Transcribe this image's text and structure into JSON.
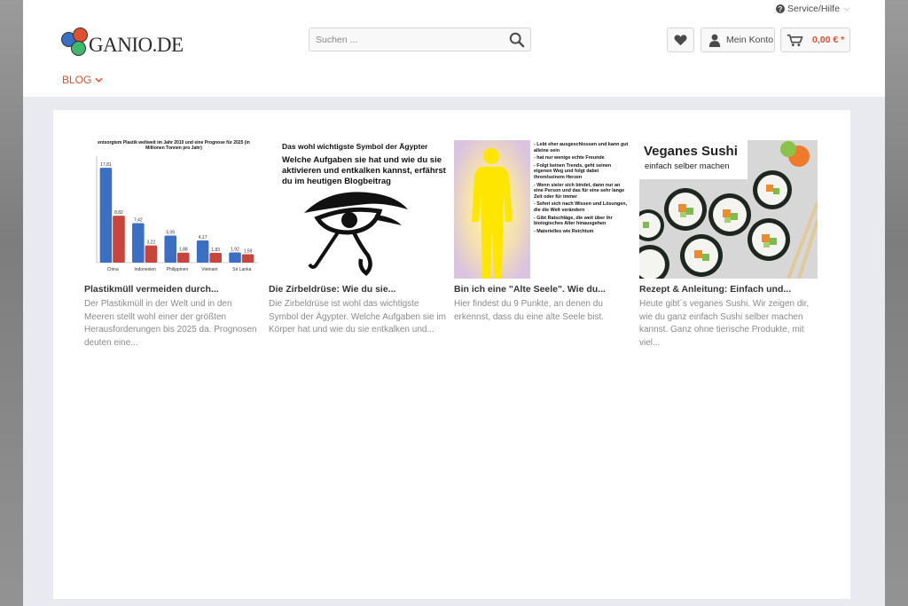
{
  "header": {
    "service_label": "Service/Hilfe",
    "logo_text": "GANIO.DE",
    "search_placeholder": "Suchen ...",
    "account_label": "Mein Konto",
    "cart_total": "0,00 € *",
    "nav_blog": "BLOG"
  },
  "colors": {
    "accent": "#e0502d",
    "bar_blue": "#3b6fc4",
    "bar_red": "#c8453b"
  },
  "icons": [
    "question-icon",
    "chevron-down-icon",
    "search-icon",
    "heart-icon",
    "user-icon",
    "cart-icon"
  ],
  "posts": [
    {
      "title": "Plastikmüll vermeiden durch...",
      "excerpt": "Der Plastikmüll in der Welt und in den Meeren stellt wohl einer der größten Herausforderungen bis 2025 da. Prognosen deuten eine..."
    },
    {
      "title": "Die Zirbeldrüse: Wie du sie...",
      "excerpt": "Die Zirbeldrüse ist wohl das wichtigste Symbol der Ägypter. Welche Aufgaben sie im Körper hat und wie du sie entkalken und...",
      "image_heading": "Das wohl wichtigste Symbol der Ägypter",
      "image_text": "Welche Aufgaben sie hat und wie du sie aktivieren und entkalken kannst, erfährst du im heutigen Blogbeitrag"
    },
    {
      "title": "Bin ich eine \"Alte Seele\". Wie du...",
      "excerpt": "Hier findest du 9 Punkte, an denen du erkennst, dass du eine alte Seele bist.",
      "image_list": [
        "- Lebt eher ausgeschlossen und kann gut alleine sein",
        "- hat nur wenige echte Freunde",
        "- Folgt keinen Trends, geht seinen eigenen Weg und folgt dabei ihrem/seinem Herzen",
        "- Wenn sie/er sich bindet, dann nur an eine Person und das für eine sehr lange Zeit oder für immer",
        "- Sehnt sich nach Wissen und Lösungen, die die Welt verändern",
        "- Gibt Ratschläge, die weit über ihr biologisches Alter hinausgehen",
        "- Materielles wie Reichtum"
      ]
    },
    {
      "title": "Rezept & Anleitung: Einfach und...",
      "excerpt": "Heute gibt´s veganes Sushi. Wir zeigen dir, wie du ganz einfach Sushi selber machen kannst. Ganz ohne tierische Produkte, mit viel...",
      "image_title": "Veganes Sushi",
      "image_subtitle": "einfach selber machen"
    }
  ],
  "chart_data": {
    "type": "bar",
    "title": "entsorgtem Plastik weltweit im Jahr 2010 und eine Prognose für 2025 (in Millionen Tonnen pro Jahr)",
    "categories": [
      "China",
      "Indonesien",
      "Philippinen",
      "Vietnam",
      "Sri Lanka"
    ],
    "series": [
      {
        "values": [
          17.81,
          7.42,
          5.09,
          4.17,
          1.92
        ],
        "labels": [
          "17,81",
          "7,42",
          "5,09",
          "4,17",
          "1,92"
        ]
      },
      {
        "values": [
          8.82,
          3.22,
          1.88,
          1.83,
          1.59
        ],
        "labels": [
          "8,82",
          "3,22",
          "1,88",
          "1,83",
          "1,59"
        ]
      }
    ],
    "ylim": [
      0,
      20
    ]
  }
}
